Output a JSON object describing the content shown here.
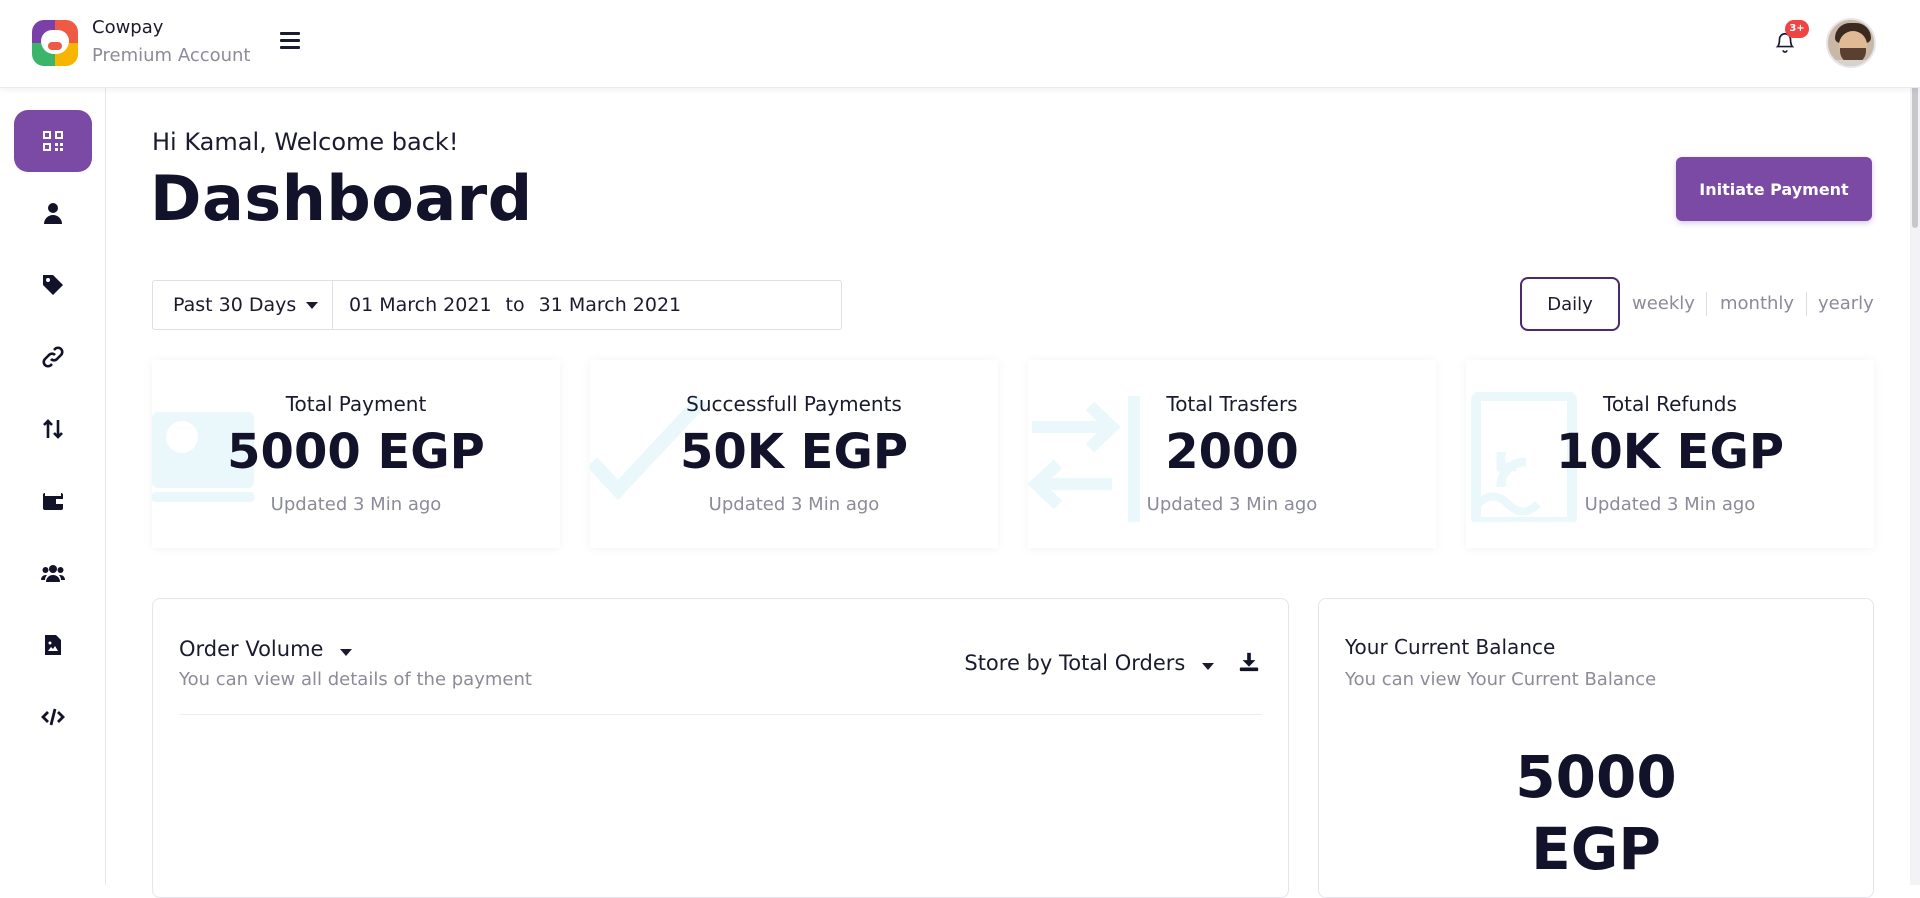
{
  "header": {
    "brand_name": "Cowpay",
    "brand_sub": "Premium Account",
    "notification_count": "3+"
  },
  "sidebar": {
    "items": [
      {
        "icon": "qr-code-icon",
        "active": true
      },
      {
        "icon": "user-icon",
        "active": false
      },
      {
        "icon": "tag-icon",
        "active": false
      },
      {
        "icon": "link-icon",
        "active": false
      },
      {
        "icon": "transfer-arrows-icon",
        "active": false
      },
      {
        "icon": "wallet-icon",
        "active": false
      },
      {
        "icon": "users-group-icon",
        "active": false
      },
      {
        "icon": "file-image-icon",
        "active": false
      },
      {
        "icon": "code-icon",
        "active": false
      }
    ]
  },
  "main": {
    "greeting": "Hi Kamal, Welcome back!",
    "title": "Dashboard",
    "initiate_button": "Initiate Payment",
    "filter": {
      "range": "Past 30 Days",
      "date_from": "01 March 2021",
      "date_sep": "to",
      "date_to": "31 March 2021"
    },
    "periods": {
      "daily": "Daily",
      "weekly": "weekly",
      "monthly": "monthly",
      "yearly": "yearly"
    },
    "stats": [
      {
        "label": "Total Payment",
        "value": "5000 EGP",
        "updated": "Updated 3 Min ago",
        "watermark": "card-icon"
      },
      {
        "label": "Successfull Payments",
        "value": "50K EGP",
        "updated": "Updated 3 Min ago",
        "watermark": "check-icon"
      },
      {
        "label": "Total Trasfers",
        "value": "2000",
        "updated": "Updated 3 Min ago",
        "watermark": "transfer-icon"
      },
      {
        "label": "Total Refunds",
        "value": "10K EGP",
        "updated": "Updated 3 Min ago",
        "watermark": "refund-icon"
      }
    ],
    "order_panel": {
      "title": "Order Volume",
      "subtitle": "You can view all details of the payment",
      "store_select": "Store by Total Orders"
    },
    "balance_panel": {
      "title": "Your Current Balance",
      "subtitle": "You can view Your Current Balance",
      "value": "5000 EGP"
    }
  },
  "colors": {
    "accent": "#7b4aa5",
    "watermark": "#eaf8fc",
    "badge": "#ef4444"
  }
}
